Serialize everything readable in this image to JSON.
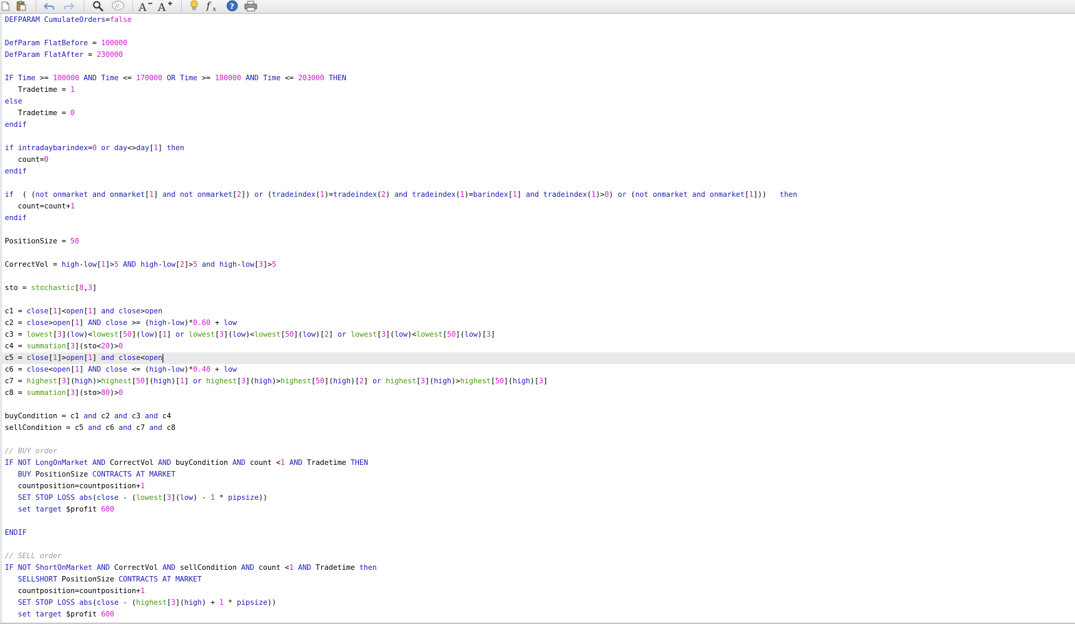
{
  "toolbar": {
    "buttons": [
      {
        "name": "new-file-icon",
        "glyph": "🗋",
        "color": "#6e6e6e"
      },
      {
        "name": "paste-icon",
        "glyph": "📋",
        "color": "#8a6a2a"
      },
      {
        "name": "undo-icon",
        "glyph": "↶",
        "color": "#6d97c9"
      },
      {
        "name": "redo-icon",
        "glyph": "↷",
        "color": "#9bb8dc"
      },
      {
        "name": "search-icon",
        "glyph": "🔍",
        "color": "#444444"
      },
      {
        "name": "comment-icon",
        "glyph": "//",
        "color": "#8c8c8c"
      },
      {
        "name": "decrease-font-icon",
        "glyph": "A",
        "color": "#333333"
      },
      {
        "name": "increase-font-icon",
        "glyph": "A",
        "color": "#333333"
      },
      {
        "name": "hint-bulb-icon",
        "glyph": "💡",
        "color": "#e5b82a"
      },
      {
        "name": "function-icon",
        "glyph": "fx",
        "color": "#222222"
      },
      {
        "name": "help-icon",
        "glyph": "?",
        "color": "#2b5fb3"
      },
      {
        "name": "print-icon",
        "glyph": "🖶",
        "color": "#555555"
      }
    ]
  },
  "colors": {
    "keyword": "#1b1bb8",
    "number": "#cc17cc",
    "function": "#4a9a12",
    "comment": "#9b9b9b",
    "current_line": "#e9e9e9"
  },
  "editor": {
    "current_line_index": 29,
    "lines": [
      "DEFPARAM CumulateOrders=false",
      "",
      "DefParam FlatBefore = 100000",
      "DefParam FlatAfter = 230000",
      "",
      "IF Time >= 100000 AND Time <= 170000 OR Time >= 180000 AND Time <= 203000 THEN",
      "   Tradetime = 1",
      "else",
      "   Tradetime = 0",
      "endif",
      "",
      "if intradaybarindex=0 or day<>day[1] then",
      "   count=0",
      "endif",
      "",
      "if  ( (not onmarket and onmarket[1] and not onmarket[2]) or (tradeindex(1)=tradeindex(2) and tradeindex(1)=barindex[1] and tradeindex(1)>0) or (not onmarket and onmarket[1]))   then",
      "   count=count+1",
      "endif",
      "",
      "PositionSize = 50",
      "",
      "CorrectVol = high-low[1]>5 AND high-low[2]>5 and high-low[3]>5",
      "",
      "sto = stochastic[8,3]",
      "",
      "c1 = close[1]<open[1] and close>open",
      "c2 = close>open[1] AND close >= (high-low)*0.60 + low",
      "c3 = lowest[3](low)<lowest[50](low)[1] or lowest[3](low)<lowest[50](low)[2] or lowest[3](low)<lowest[50](low)[3]",
      "c4 = summation[3](sto<20)>0",
      "c5 = close[1]>open[1] and close<open",
      "c6 = close<open[1] AND close <= (high-low)*0.40 + low",
      "c7 = highest[3](high)>highest[50](high)[1] or highest[3](high)>highest[50](high)[2] or highest[3](high)>highest[50](high)[3]",
      "c8 = summation[3](sto>80)>0",
      "",
      "buyCondition = c1 and c2 and c3 and c4",
      "sellCondition = c5 and c6 and c7 and c8",
      "",
      "// BUY order",
      "IF NOT LongOnMarket AND CorrectVol AND buyCondition AND count <1 AND Tradetime THEN",
      "   BUY PositionSize CONTRACTS AT MARKET",
      "   countposition=countposition+1",
      "   SET STOP LOSS abs(close - (lowest[3](low) - 1 * pipsize))",
      "   set target $profit 600",
      "",
      "ENDIF",
      "",
      "// SELL order",
      "IF NOT ShortOnMarket AND CorrectVol AND sellCondition AND count <1 AND Tradetime then",
      "   SELLSHORT PositionSize CONTRACTS AT MARKET",
      "   countposition=countposition+1",
      "   SET STOP LOSS abs(close - (highest[3](high) + 1 * pipsize))",
      "   set target $profit 600"
    ]
  }
}
